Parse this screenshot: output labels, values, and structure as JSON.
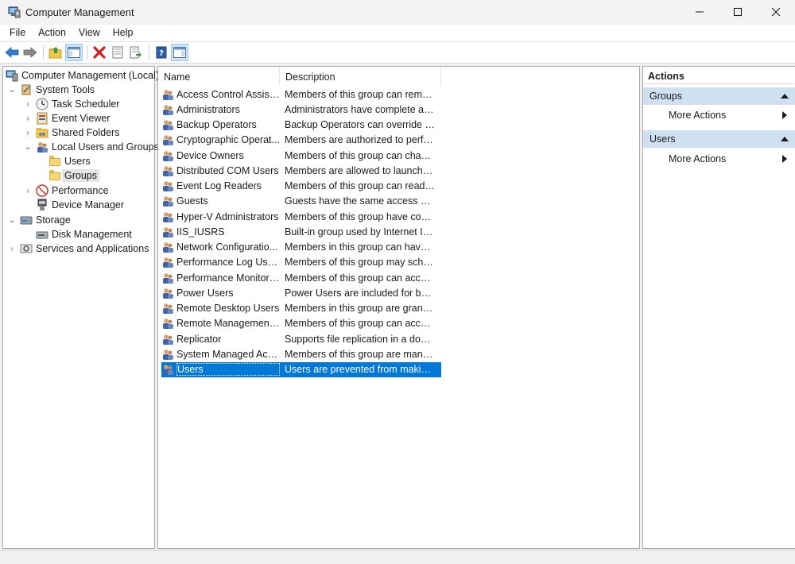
{
  "window": {
    "title": "Computer Management"
  },
  "menu": [
    "File",
    "Action",
    "View",
    "Help"
  ],
  "tree": [
    {
      "label": "Computer Management (Local)",
      "level": 0,
      "expander": "",
      "icon": "computer-management-icon"
    },
    {
      "label": "System Tools",
      "level": 1,
      "expander": "expanded",
      "icon": "system-tools-icon"
    },
    {
      "label": "Task Scheduler",
      "level": 2,
      "expander": "collapsed",
      "icon": "clock-icon"
    },
    {
      "label": "Event Viewer",
      "level": 2,
      "expander": "collapsed",
      "icon": "event-viewer-icon"
    },
    {
      "label": "Shared Folders",
      "level": 2,
      "expander": "collapsed",
      "icon": "shared-folders-icon"
    },
    {
      "label": "Local Users and Groups",
      "level": 2,
      "expander": "expanded",
      "icon": "users-groups-icon"
    },
    {
      "label": "Users",
      "level": 3,
      "expander": "",
      "icon": "folder-icon"
    },
    {
      "label": "Groups",
      "level": 3,
      "expander": "",
      "icon": "folder-icon",
      "selected": true
    },
    {
      "label": "Performance",
      "level": 2,
      "expander": "collapsed",
      "icon": "performance-icon"
    },
    {
      "label": "Device Manager",
      "level": 2,
      "expander": "",
      "icon": "device-manager-icon"
    },
    {
      "label": "Storage",
      "level": 1,
      "expander": "expanded",
      "icon": "storage-icon"
    },
    {
      "label": "Disk Management",
      "level": 2,
      "expander": "",
      "icon": "disk-management-icon"
    },
    {
      "label": "Services and Applications",
      "level": 1,
      "expander": "collapsed",
      "icon": "services-icon"
    }
  ],
  "list": {
    "columns": [
      "Name",
      "Description"
    ],
    "rows": [
      {
        "name": "Access Control Assista...",
        "description": "Members of this group can remot..."
      },
      {
        "name": "Administrators",
        "description": "Administrators have complete and..."
      },
      {
        "name": "Backup Operators",
        "description": "Backup Operators can override sec..."
      },
      {
        "name": "Cryptographic Operat...",
        "description": "Members are authorized to perfor..."
      },
      {
        "name": "Device Owners",
        "description": "Members of this group can chang..."
      },
      {
        "name": "Distributed COM Users",
        "description": "Members are allowed to launch, ac..."
      },
      {
        "name": "Event Log Readers",
        "description": "Members of this group can read e..."
      },
      {
        "name": "Guests",
        "description": "Guests have the same access as m..."
      },
      {
        "name": "Hyper-V Administrators",
        "description": "Members of this group have comp..."
      },
      {
        "name": "IIS_IUSRS",
        "description": "Built-in group used by Internet Inf..."
      },
      {
        "name": "Network Configuratio...",
        "description": "Members in this group can have s..."
      },
      {
        "name": "Performance Log Users",
        "description": "Members of this group may sched..."
      },
      {
        "name": "Performance Monitor ...",
        "description": "Members of this group can access ..."
      },
      {
        "name": "Power Users",
        "description": "Power Users are included for back..."
      },
      {
        "name": "Remote Desktop Users",
        "description": "Members in this group are grante..."
      },
      {
        "name": "Remote Management ...",
        "description": "Members of this group can access ..."
      },
      {
        "name": "Replicator",
        "description": "Supports file replication in a doma..."
      },
      {
        "name": "System Managed Acco...",
        "description": "Members of this group are manag..."
      },
      {
        "name": "Users",
        "description": "Users are prevented from making ...",
        "selected": true
      }
    ]
  },
  "actions": {
    "title": "Actions",
    "sections": [
      {
        "label": "Groups",
        "items": [
          "More Actions"
        ]
      },
      {
        "label": "Users",
        "items": [
          "More Actions"
        ]
      }
    ]
  },
  "colors": {
    "selection": "#0078d7",
    "section_header": "#cfe0f1",
    "tree_selection": "#e5e5e5"
  }
}
